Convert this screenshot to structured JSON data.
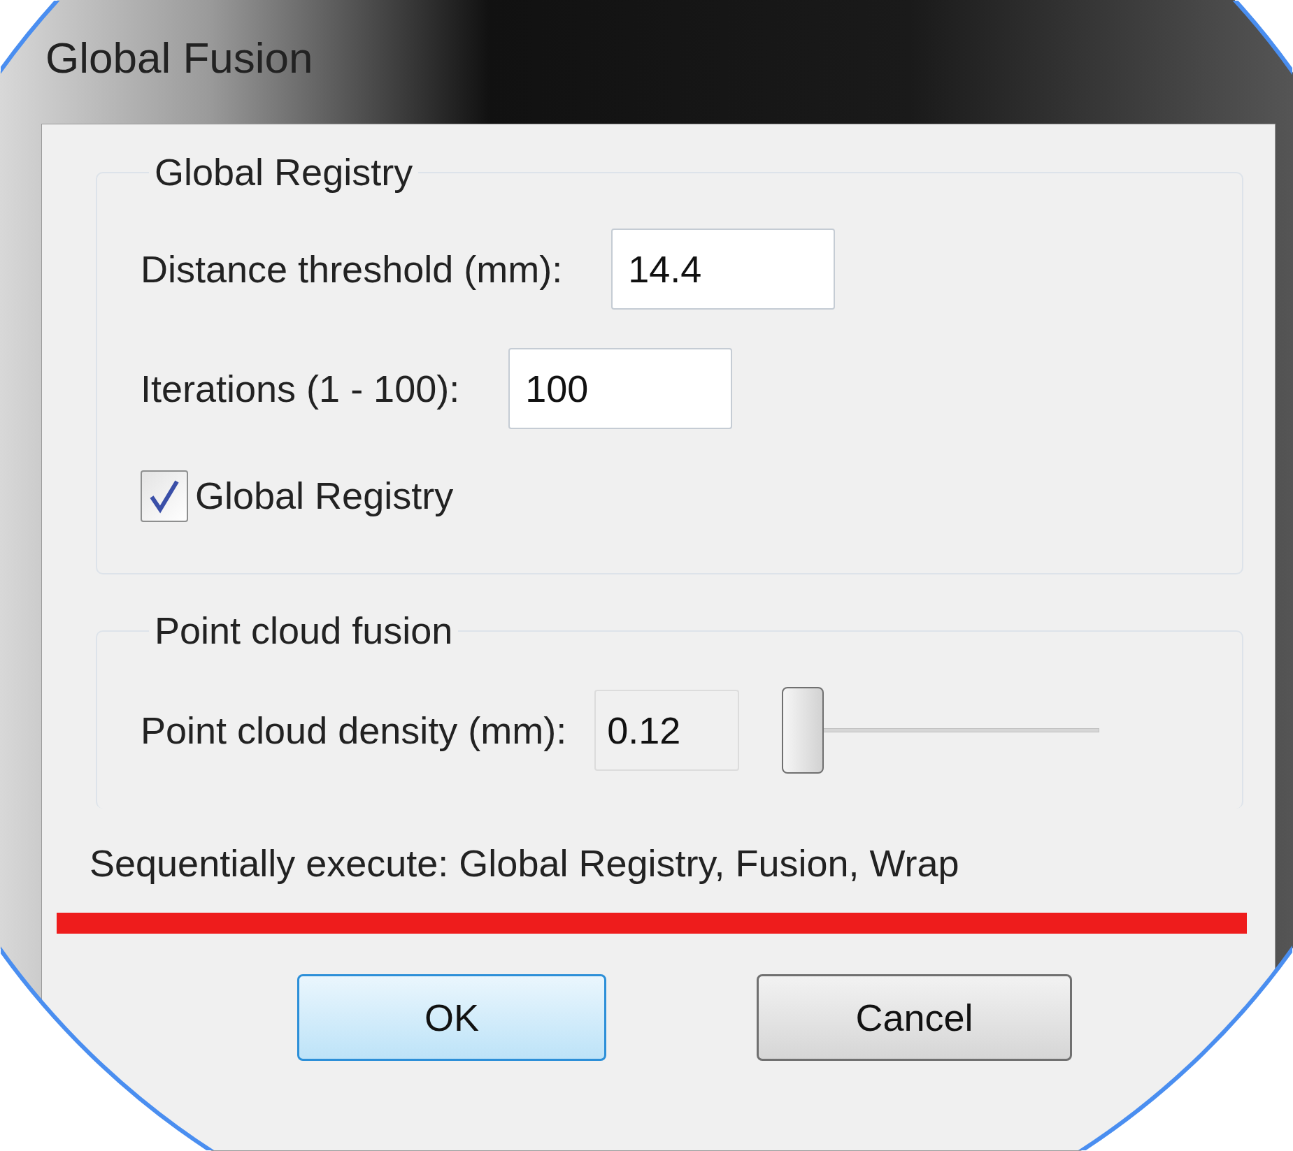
{
  "window": {
    "title": "Global Fusion"
  },
  "groups": [
    {
      "title": "Global Registry",
      "fields": [
        {
          "kind": "input",
          "label": "Distance threshold (mm):",
          "value": "14.4"
        },
        {
          "kind": "input",
          "label": "Iterations (1 - 100):",
          "value": "100"
        },
        {
          "kind": "checkbox",
          "label": "Global Registry",
          "checked": true
        }
      ]
    },
    {
      "title": "Point cloud fusion",
      "fields": [
        {
          "kind": "slider",
          "label": "Point cloud density (mm):",
          "value": "0.12",
          "level": 0
        }
      ]
    }
  ],
  "status_text": "Sequentially execute: Global Registry, Fusion, Wrap",
  "buttons": [
    {
      "label": "OK",
      "default": true
    },
    {
      "label": "Cancel",
      "default": false
    }
  ]
}
